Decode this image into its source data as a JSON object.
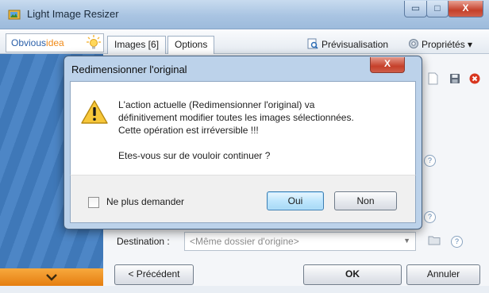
{
  "window": {
    "title": "Light Image Resizer",
    "controls": {
      "minimize": "▭",
      "maximize": "□",
      "close": "X"
    }
  },
  "tabbar": {
    "logo": {
      "part1": "Obvious",
      "part2": "idea"
    },
    "tabs": [
      "Images [6]",
      "Options"
    ],
    "preview_label": "Prévisualisation",
    "properties_label": "Propriétés ▾"
  },
  "form": {
    "destination_label": "Destination :",
    "destination_value": "<Même dossier d'origine>",
    "help_glyph": "?"
  },
  "buttons": {
    "previous": "< Précédent",
    "ok": "OK",
    "cancel": "Annuler"
  },
  "dialog": {
    "title": "Redimensionner l'original",
    "close": "X",
    "message_lines": [
      "L'action actuelle (Redimensionner l'original) va",
      "définitivement modifier toutes les images sélectionnées.",
      "Cette opération est irréversible !!!"
    ],
    "question": "Etes-vous sur de vouloir continuer ?",
    "checkbox_label": "Ne plus demander",
    "yes": "Oui",
    "no": "Non"
  },
  "colors": {
    "accent_orange": "#e57e10",
    "sidebar_blue": "#3f78b8",
    "close_red": "#c5402a"
  },
  "icons": [
    "folder-image-icon",
    "bulb-icon",
    "preview-icon",
    "properties-icon",
    "document-icon",
    "save-icon",
    "delete-icon",
    "folder-icon",
    "warning-icon",
    "chevron-down-icon"
  ]
}
